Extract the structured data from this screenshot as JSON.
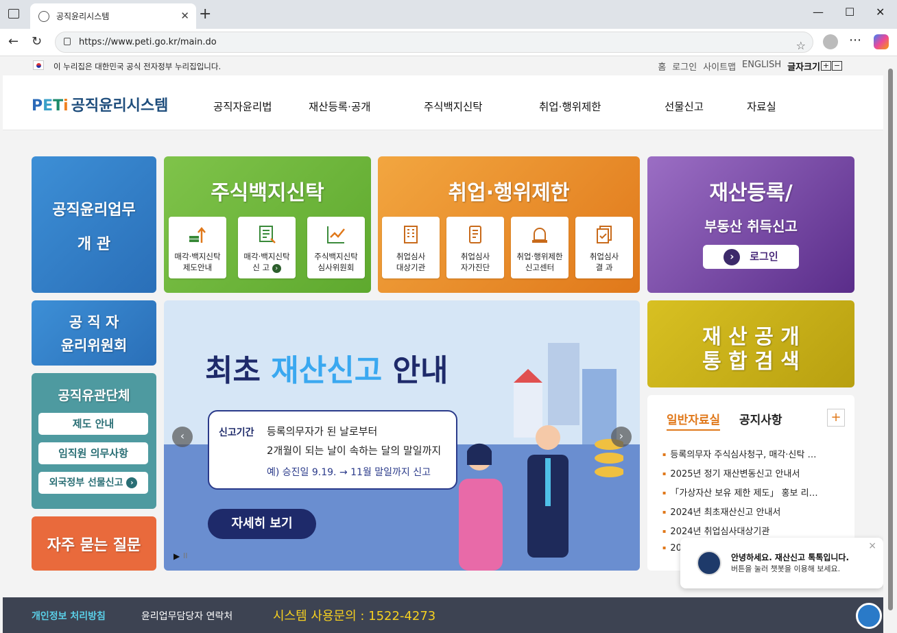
{
  "browser": {
    "tab_title": "공직윤리시스템",
    "url": "https://www.peti.go.kr/main.do"
  },
  "topstrip": {
    "gov_notice": "이 누리집은 대한민국 공식 전자정부 누리집입니다.",
    "links": [
      "홈",
      "로그인",
      "사이트맵",
      "ENGLISH"
    ],
    "font_size_label": "글자크기",
    "font_plus": "+",
    "font_minus": "−"
  },
  "header": {
    "logo_p": "P",
    "logo_e": "E",
    "logo_t": "T",
    "logo_i": "i",
    "logo_name": "공직윤리시스템",
    "menu": [
      "공직자윤리법",
      "재산등록·공개",
      "주식백지신탁",
      "취업·행위제한",
      "선물신고",
      "자료실"
    ]
  },
  "tiles": {
    "overview_line1": "공직윤리업무",
    "overview_line2": "개 관",
    "stock_title": "주식백지신탁",
    "stock_cards": [
      {
        "l1": "매각·백지신탁",
        "l2": "제도안내"
      },
      {
        "l1": "매각·백지신탁",
        "l2": "신 고"
      },
      {
        "l1": "주식백지신탁",
        "l2": "심사위원회"
      }
    ],
    "employ_title": "취업·행위제한",
    "employ_cards": [
      {
        "l1": "취업심사",
        "l2": "대상기관"
      },
      {
        "l1": "취업심사",
        "l2": "자가진단"
      },
      {
        "l1": "취업·행위제한",
        "l2": "신고센터"
      },
      {
        "l1": "취업심사",
        "l2": "결 과"
      }
    ],
    "property_line1": "재산등록/",
    "property_line2": "부동산 취득신고",
    "property_login": "로그인",
    "committee_line1": "공 직 자",
    "committee_line2": "윤리위원회",
    "org_title": "공직유관단체",
    "org_buttons": [
      "제도 안내",
      "임직원 의무사항",
      "외국정부 선물신고"
    ],
    "faq": "자주 묻는 질문",
    "disclosure_line1": "재 산 공 개",
    "disclosure_line2": "통 합 검 색"
  },
  "banner": {
    "title_a": "최초",
    "title_b": "재산신고",
    "title_c": "안내",
    "period_label": "신고기간",
    "period_line1": "등록의무자가 된 날로부터",
    "period_line2": "2개월이 되는 날이 속하는 달의 말일까지",
    "period_example": "예) 승진일 9.19. → 11월 말일까지 신고",
    "detail_button": "자세히 보기",
    "prev": "‹",
    "next": "›",
    "play": "▶",
    "pause": "II"
  },
  "news": {
    "tab_active": "일반자료실",
    "tab_other": "공지사항",
    "more": "+",
    "items": [
      "등록의무자 주식심사청구, 매각·신탁 …",
      "2025년 정기 재산변동신고 안내서",
      "「가상자산 보유 제한 제도」 홍보 리…",
      "2024년 최초재산신고 안내서",
      "2024년 취업심사대상기관",
      "20"
    ]
  },
  "chat": {
    "line1": "안녕하세요. 재산신고 톡톡입니다.",
    "line2": "버튼을 눌러 챗봇을 이용해 보세요.",
    "close": "×"
  },
  "footer": {
    "privacy": "개인정보 처리방침",
    "contact": "윤리업무담당자 연락처",
    "system_label": "시스템 사용문의 : 1522-4273"
  }
}
